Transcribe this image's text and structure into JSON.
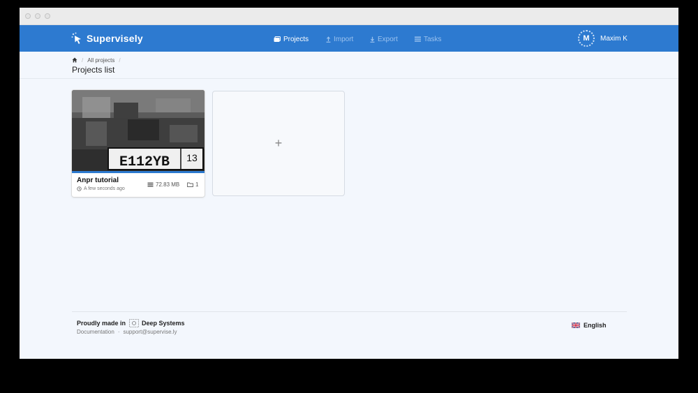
{
  "brand": {
    "name": "Supervisely"
  },
  "nav": {
    "projects": "Projects",
    "import": "Import",
    "export": "Export",
    "tasks": "Tasks"
  },
  "user": {
    "initial": "M",
    "name": "Maxim K"
  },
  "breadcrumb": {
    "current": "All projects"
  },
  "page": {
    "title": "Projects list"
  },
  "projects": [
    {
      "name": "Anpr tutorial",
      "updated": "A few seconds ago",
      "size": "72.83 MB",
      "datasets": "1",
      "plate_text": "E112YB",
      "plate_region": "13"
    }
  ],
  "add_card": {
    "symbol": "+"
  },
  "footer": {
    "made_in": "Proudly made in",
    "company": "Deep Systems",
    "documentation": "Documentation",
    "separator": "·",
    "support": "support@supervise.ly",
    "language": "English"
  },
  "colors": {
    "brand_blue": "#2d7ad0",
    "page_bg": "#f3f7fd"
  }
}
